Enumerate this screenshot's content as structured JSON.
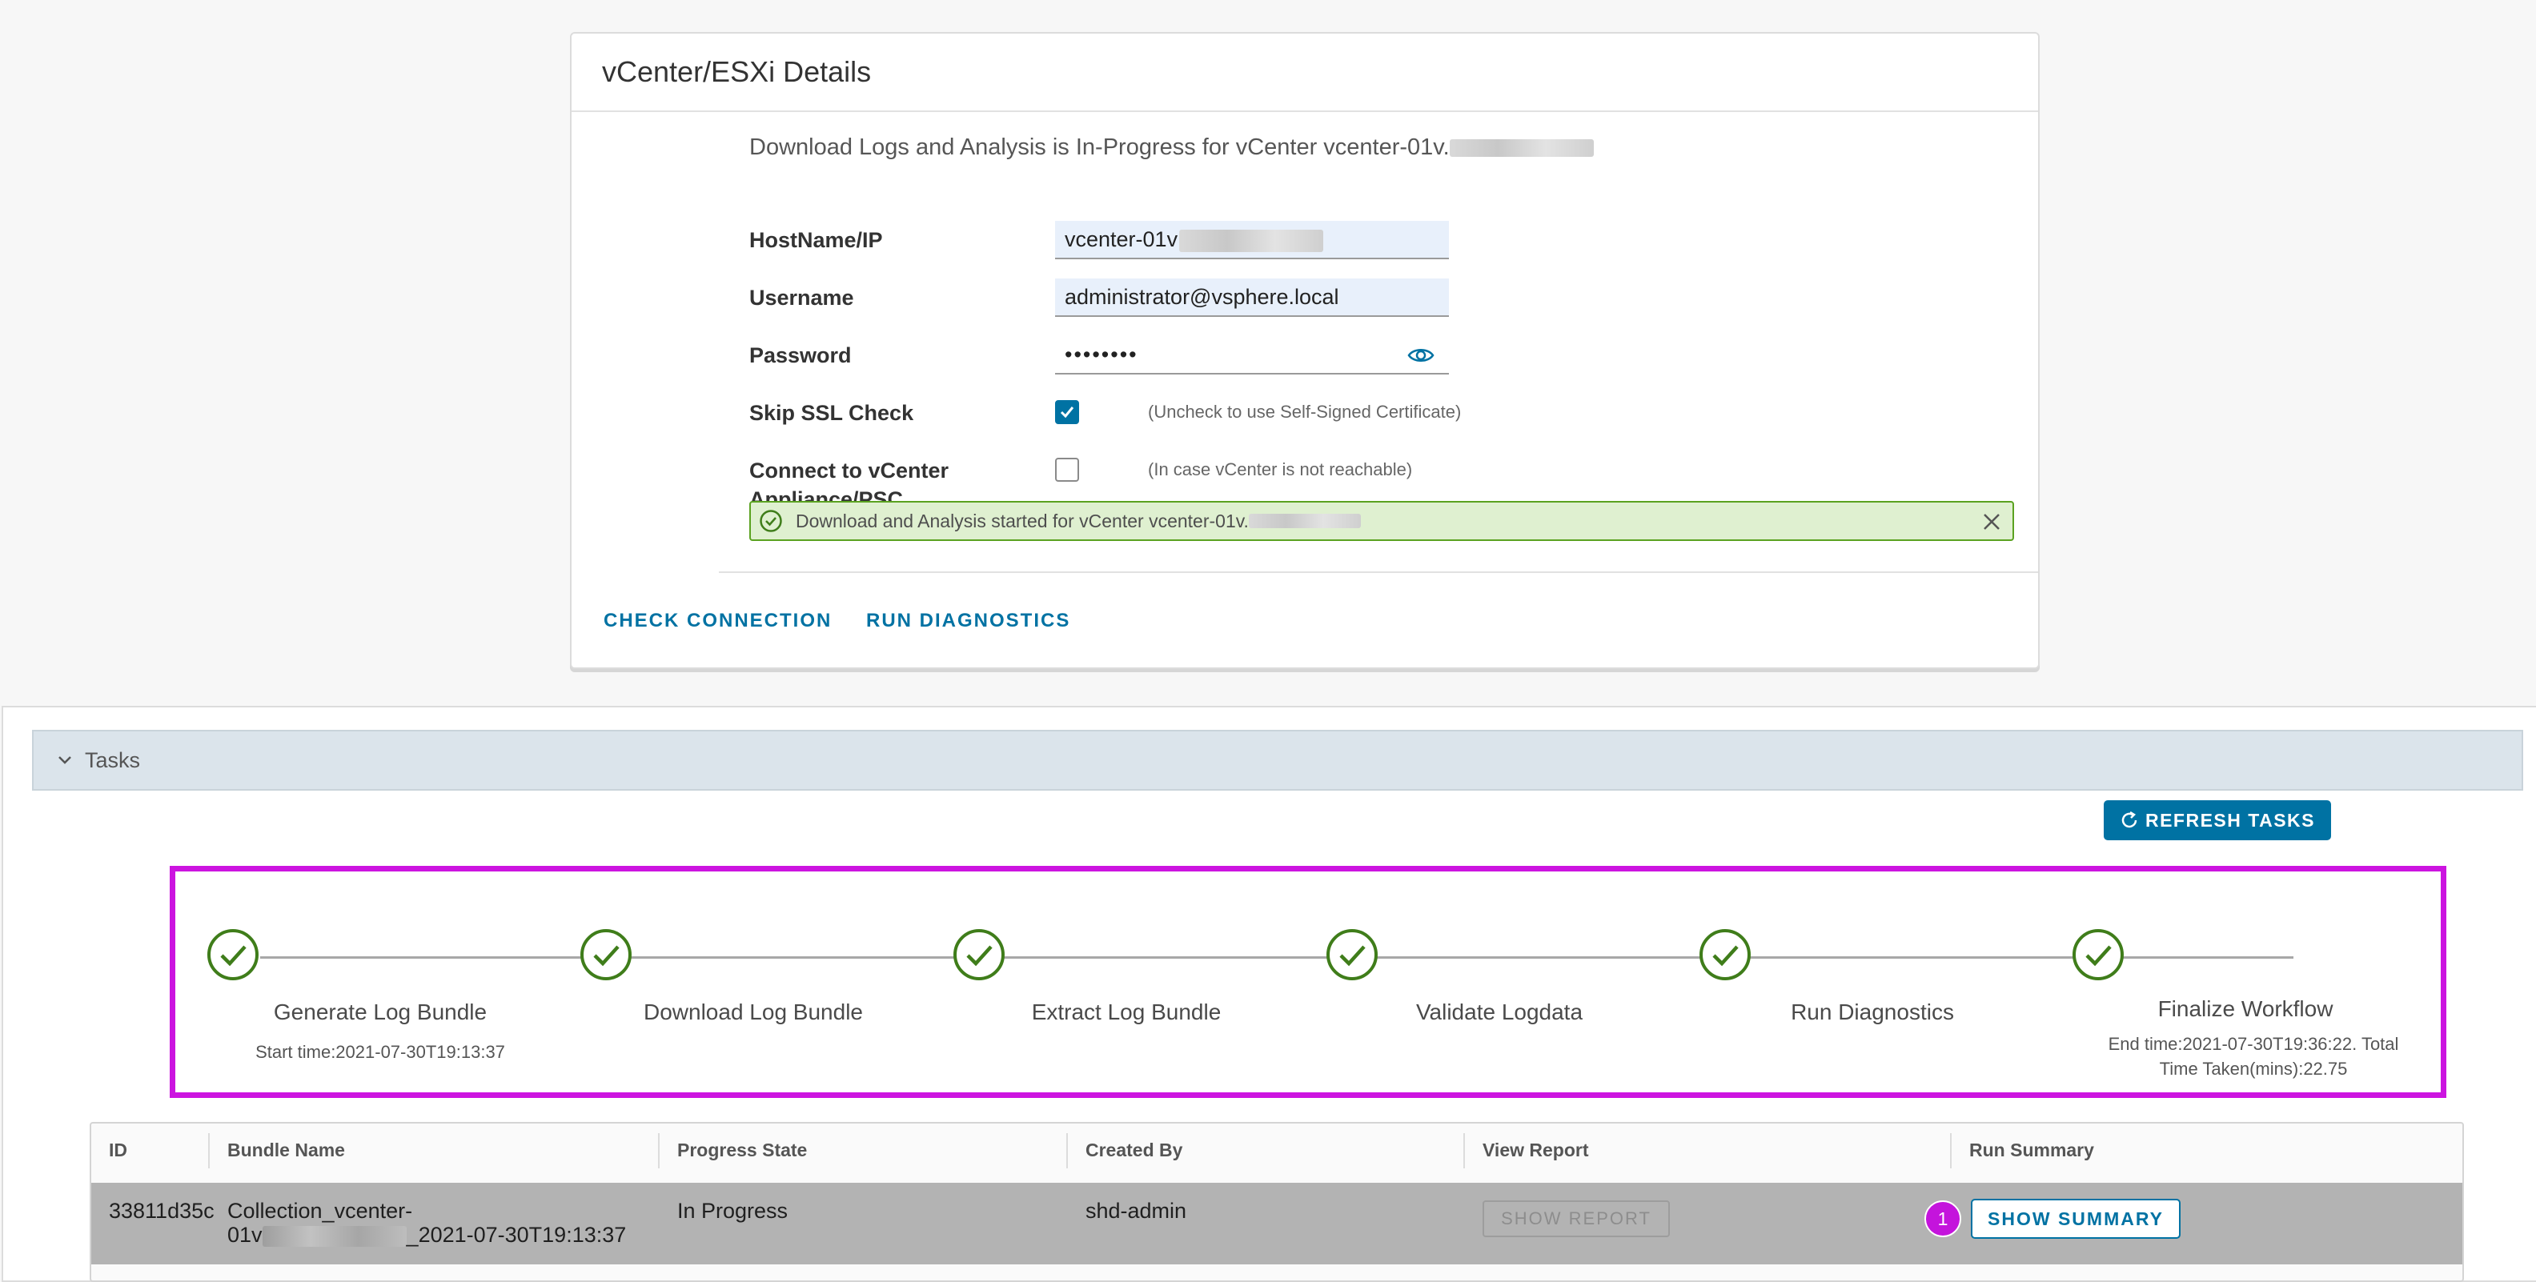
{
  "details": {
    "title": "vCenter/ESXi Details",
    "status_text": "Download Logs and Analysis is In-Progress for vCenter vcenter-01v.",
    "hostname_label": "HostName/IP",
    "hostname_value": "vcenter-01v",
    "username_label": "Username",
    "username_value": "administrator@vsphere.local",
    "password_label": "Password",
    "password_value": "••••••••",
    "skip_ssl_label": "Skip SSL Check",
    "skip_ssl_checked": true,
    "skip_ssl_hint": "(Uncheck to use Self-Signed Certificate)",
    "connect_label_line1": "Connect to vCenter",
    "connect_label_line2": "Appliance/PSC",
    "connect_checked": false,
    "connect_hint": "(In case vCenter is not reachable)",
    "alert_text": "Download and Analysis started for vCenter vcenter-01v.",
    "check_connection_label": "CHECK CONNECTION",
    "run_diagnostics_label": "RUN DIAGNOSTICS"
  },
  "tasks": {
    "header_label": "Tasks",
    "refresh_label": "REFRESH TASKS",
    "workflow": {
      "steps": [
        {
          "label": "Generate Log Bundle",
          "status": "complete"
        },
        {
          "label": "Download Log Bundle",
          "status": "complete"
        },
        {
          "label": "Extract Log Bundle",
          "status": "complete"
        },
        {
          "label": "Validate Logdata",
          "status": "complete"
        },
        {
          "label": "Run Diagnostics",
          "status": "complete"
        },
        {
          "label": "Finalize Workflow",
          "status": "complete"
        }
      ],
      "start_time_text": "Start time:2021-07-30T19:13:37",
      "end_time_line1": "End time:2021-07-30T19:36:22. Total",
      "end_time_line2": "Time Taken(mins):22.75"
    },
    "table": {
      "columns": [
        "ID",
        "Bundle Name",
        "Progress State",
        "Created By",
        "View Report",
        "Run Summary"
      ],
      "rows": [
        {
          "id": "33811d35c",
          "bundle_name_line1": "Collection_vcenter-",
          "bundle_name_line2_prefix": "01v",
          "bundle_name_line2_suffix": "_2021-07-30T19:13:37",
          "progress_state": "In Progress",
          "created_by": "shd-admin",
          "show_report_label": "SHOW REPORT",
          "summary_badge": "1",
          "show_summary_label": "SHOW SUMMARY"
        }
      ]
    }
  },
  "colors": {
    "accent": "#0072a3",
    "success_green": "#3f7d1a",
    "highlight_magenta": "#cc14e0"
  }
}
